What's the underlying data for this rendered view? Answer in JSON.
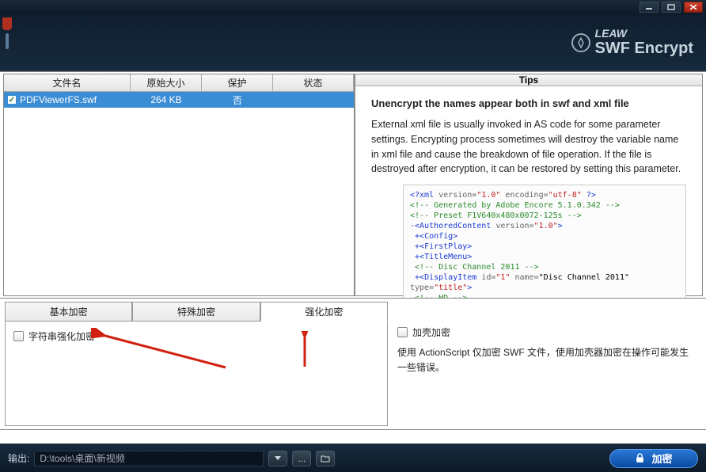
{
  "brand": {
    "line1": "LEAW",
    "line2": "SWF Encrypt"
  },
  "fileTable": {
    "headers": {
      "name": "文件名",
      "size": "原始大小",
      "prot": "保护",
      "stat": "状态"
    },
    "row": {
      "name": "PDFViewerFS.swf",
      "size": "264 KB",
      "prot": "否",
      "stat": ""
    }
  },
  "tips": {
    "title": "Tips",
    "heading": "Unencrypt the names appear both in swf and xml file",
    "body": "External xml file is usually invoked in AS code for some parameter settings. Encrypting process sometimes will destroy the variable name in xml file and cause the breakdown of file operation. If the file is destroyed after encryption, it can be restored by setting this parameter."
  },
  "tabs": {
    "basic": "基本加密",
    "special": "特殊加密",
    "strengthen": "强化加密"
  },
  "leftOption": {
    "label": "字符串强化加密"
  },
  "rightOption": {
    "label": "加壳加密",
    "desc": "使用 ActionScript 仅加密 SWF 文件，使用加壳器加密在操作可能发生一些错误。"
  },
  "bottom": {
    "outLabel": "输出:",
    "outPath": "D:\\tools\\桌面\\新视频",
    "btn": "加密"
  }
}
